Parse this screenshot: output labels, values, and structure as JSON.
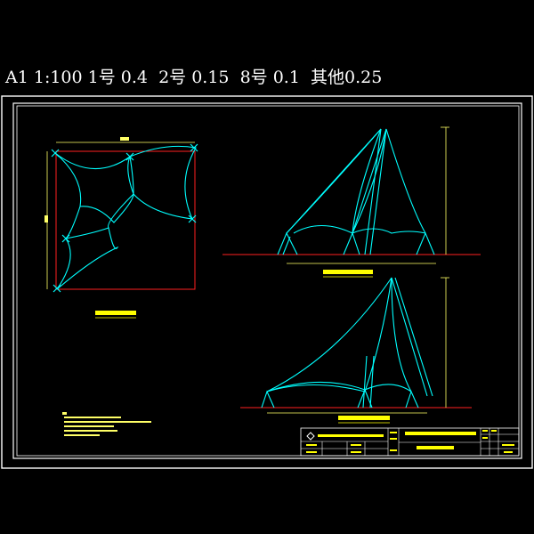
{
  "header": {
    "plot_spec": "A1 1:100 1号 0.4  2号 0.15  8号 0.1  其他0.25"
  },
  "colors": {
    "background": "#000000",
    "frame": "#ffffff",
    "membrane": "#00ffff",
    "ground_line": "#ff2020",
    "dimension": "#ffff66",
    "text": "#ffff00",
    "title_block": "#ffffff"
  },
  "drawing": {
    "elements": [
      "plan-view",
      "front-elevation",
      "side-elevation",
      "notes",
      "title-block"
    ]
  }
}
